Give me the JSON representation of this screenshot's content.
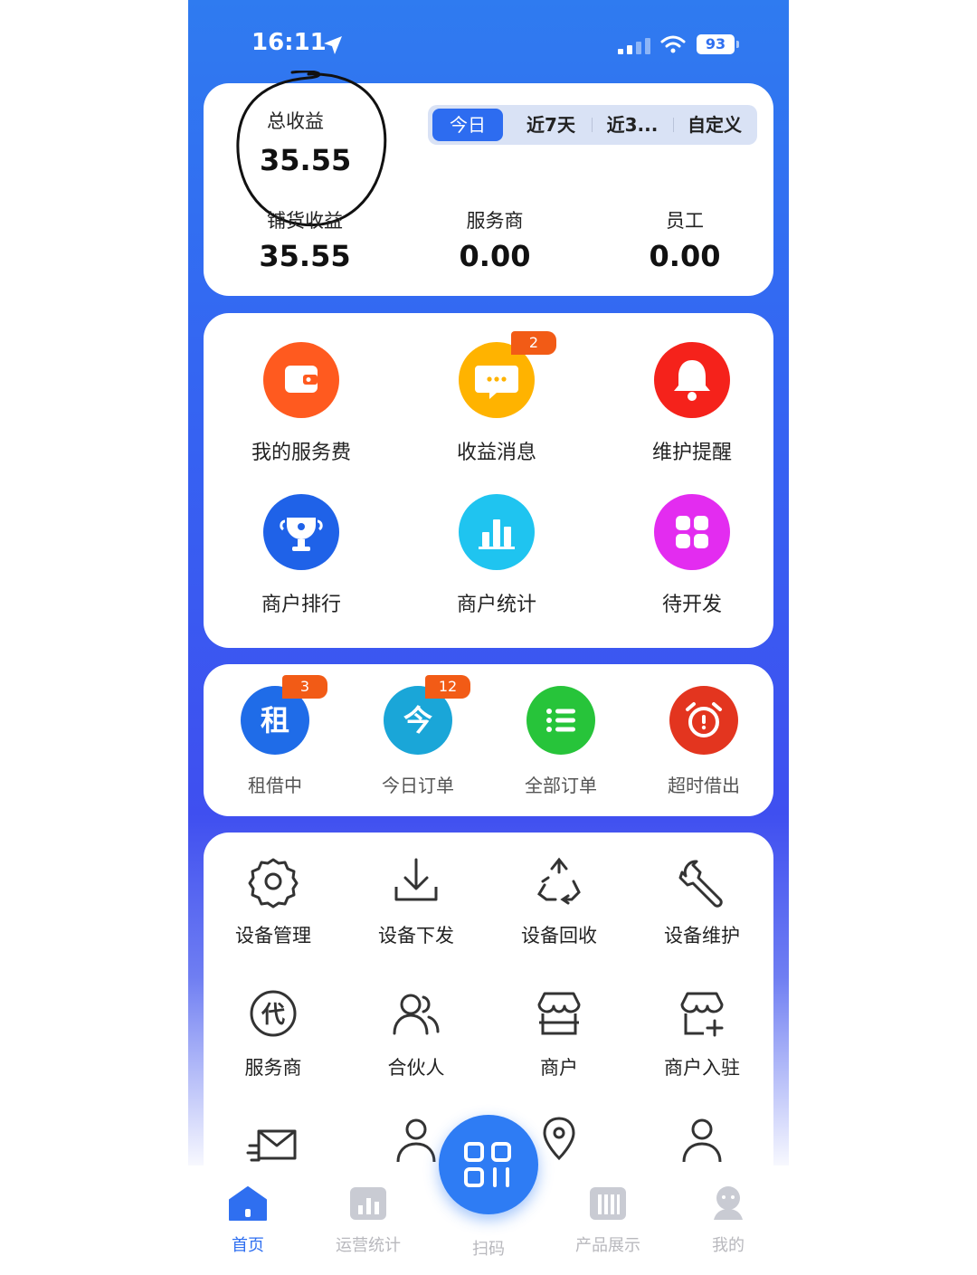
{
  "status_bar": {
    "time": "16:11",
    "battery": "93"
  },
  "summary": {
    "total_label": "总收益",
    "total_value": "35.55",
    "periods": [
      "今日",
      "近7天",
      "近3...",
      "自定义"
    ],
    "active_period": "今日",
    "stats": [
      {
        "label": "铺货收益",
        "value": "35.55"
      },
      {
        "label": "服务商",
        "value": "0.00"
      },
      {
        "label": "员工",
        "value": "0.00"
      }
    ]
  },
  "quick_menu": [
    {
      "label": "我的服务费",
      "icon": "wallet-icon",
      "color": "#ff5a1f"
    },
    {
      "label": "收益消息",
      "icon": "message-icon",
      "color": "#ffb300",
      "badge": "2"
    },
    {
      "label": "维护提醒",
      "icon": "bell-icon",
      "color": "#f5221b"
    },
    {
      "label": "商户排行",
      "icon": "trophy-icon",
      "color": "#1f62e8"
    },
    {
      "label": "商户统计",
      "icon": "bar-chart-icon",
      "color": "#1fc4f0"
    },
    {
      "label": "待开发",
      "icon": "grid-icon",
      "color": "#e32cf0"
    }
  ],
  "orders": [
    {
      "label": "租借中",
      "glyph": "租",
      "icon": "renting-icon",
      "color": "#1f6ce8",
      "badge": "3"
    },
    {
      "label": "今日订单",
      "glyph": "今",
      "icon": "today-order-icon",
      "color": "#1aa6d8",
      "badge": "12"
    },
    {
      "label": "全部订单",
      "glyph": "≡",
      "icon": "list-icon",
      "color": "#27c43a"
    },
    {
      "label": "超时借出",
      "glyph": "⏰",
      "icon": "alarm-icon",
      "color": "#e3351f"
    }
  ],
  "tools": [
    {
      "label": "设备管理",
      "icon": "gear-icon"
    },
    {
      "label": "设备下发",
      "icon": "download-icon"
    },
    {
      "label": "设备回收",
      "icon": "recycle-icon"
    },
    {
      "label": "设备维护",
      "icon": "wrench-icon"
    },
    {
      "label": "服务商",
      "icon": "agent-icon"
    },
    {
      "label": "合伙人",
      "icon": "partners-icon"
    },
    {
      "label": "商户",
      "icon": "store-icon"
    },
    {
      "label": "商户入驻",
      "icon": "store-add-icon"
    }
  ],
  "tabbar": {
    "items": [
      "首页",
      "运营统计",
      "产品展示",
      "我的"
    ],
    "scan": "扫码",
    "active": "首页"
  },
  "colors": {
    "accent": "#2f6ff0",
    "badge": "#f25b16"
  }
}
